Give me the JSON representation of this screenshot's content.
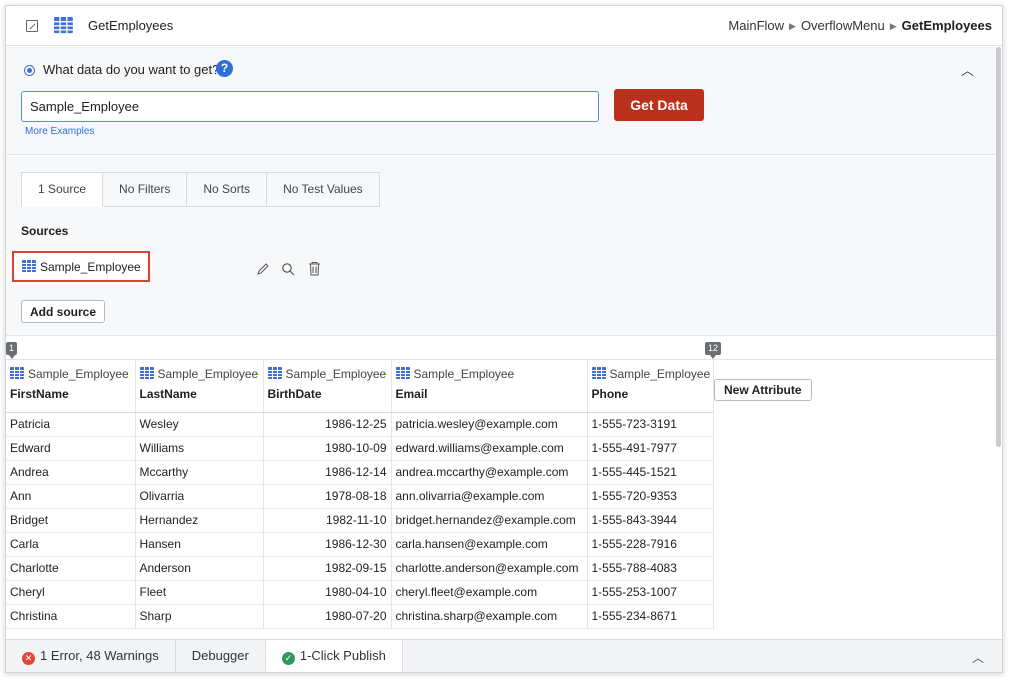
{
  "header": {
    "title": "GetEmployees",
    "breadcrumb": [
      "MainFlow",
      "OverflowMenu",
      "GetEmployees"
    ]
  },
  "query": {
    "question": "What data do you want to get?",
    "help": "?",
    "input_value": "Sample_Employee",
    "get_data_label": "Get Data",
    "more_examples": "More Examples"
  },
  "tabs": [
    "1 Source",
    "No Filters",
    "No Sorts",
    "No Test Values"
  ],
  "sources": {
    "label": "Sources",
    "items": [
      "Sample_Employee"
    ],
    "add_label": "Add source"
  },
  "grid": {
    "markers": [
      "1",
      "12"
    ],
    "new_attribute_label": "New Attribute",
    "columns": [
      {
        "source": "Sample_Employee",
        "attr": "FirstName"
      },
      {
        "source": "Sample_Employee",
        "attr": "LastName"
      },
      {
        "source": "Sample_Employee",
        "attr": "BirthDate"
      },
      {
        "source": "Sample_Employee",
        "attr": "Email"
      },
      {
        "source": "Sample_Employee",
        "attr": "Phone"
      }
    ],
    "rows": [
      [
        "Patricia",
        "Wesley",
        "1986-12-25",
        "patricia.wesley@example.com",
        "1-555-723-3191"
      ],
      [
        "Edward",
        "Williams",
        "1980-10-09",
        "edward.williams@example.com",
        "1-555-491-7977"
      ],
      [
        "Andrea",
        "Mccarthy",
        "1986-12-14",
        "andrea.mccarthy@example.com",
        "1-555-445-1521"
      ],
      [
        "Ann",
        "Olivarria",
        "1978-08-18",
        "ann.olivarria@example.com",
        "1-555-720-9353"
      ],
      [
        "Bridget",
        "Hernandez",
        "1982-11-10",
        "bridget.hernandez@example.com",
        "1-555-843-3944"
      ],
      [
        "Carla",
        "Hansen",
        "1986-12-30",
        "carla.hansen@example.com",
        "1-555-228-7916"
      ],
      [
        "Charlotte",
        "Anderson",
        "1982-09-15",
        "charlotte.anderson@example.com",
        "1-555-788-4083"
      ],
      [
        "Cheryl",
        "Fleet",
        "1980-04-10",
        "cheryl.fleet@example.com",
        "1-555-253-1007"
      ],
      [
        "Christina",
        "Sharp",
        "1980-07-20",
        "christina.sharp@example.com",
        "1-555-234-8671"
      ]
    ]
  },
  "footer": {
    "errors_label": "1 Error, 48 Warnings",
    "debugger_label": "Debugger",
    "publish_label": "1-Click Publish"
  },
  "colors": {
    "accent": "#2d6fd6",
    "get_data_button": "#b9301c",
    "highlight_border": "#d9432f",
    "error": "#e0483a",
    "success": "#2e9a5e"
  },
  "icons": [
    "expand-icon",
    "table-icon",
    "radio-icon",
    "help-icon",
    "chevron-up-icon",
    "edit-icon",
    "search-icon",
    "delete-icon",
    "error-icon",
    "check-icon"
  ]
}
